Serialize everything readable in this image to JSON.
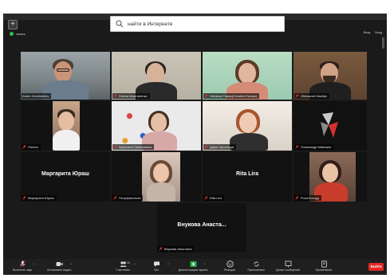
{
  "search": {
    "placeholder": "найти в Интернете"
  },
  "status": {
    "label": "запись"
  },
  "top_right": {
    "item1": "Вход",
    "item2": "Вход"
  },
  "participants": [
    {
      "id": "p1",
      "name": "Anton Ovchinnikov",
      "muted": false,
      "active": true
    },
    {
      "id": "p2",
      "name": "Олена Мартиненко",
      "muted": true
    },
    {
      "id": "p3",
      "name": "Наталка Тимко(Creative Europe)",
      "muted": true
    },
    {
      "id": "p4",
      "name": "Oleksandr Manilyk",
      "muted": true
    },
    {
      "id": "p5",
      "name": "Поліна",
      "muted": true
    },
    {
      "id": "p6",
      "name": "Христина Омельченко",
      "muted": true
    },
    {
      "id": "p7",
      "name": "Дарія Хроллида",
      "muted": true
    },
    {
      "id": "p8",
      "name": "Олександр Манішкін",
      "muted": true
    },
    {
      "id": "p9",
      "name": "Маргарита Юраш",
      "muted": true,
      "display_name": "Маргарита Юраш"
    },
    {
      "id": "p10",
      "name": "Потрерікальна",
      "muted": true
    },
    {
      "id": "p11",
      "name": "Rita Lira",
      "muted": true,
      "display_name": "Rita Lira"
    },
    {
      "id": "p12",
      "name": "Роса Богоуд",
      "muted": true
    },
    {
      "id": "p13",
      "name": "Внукова Анастасія",
      "muted": true,
      "display_name": "Внукова Анаста..."
    }
  ],
  "toolbar": {
    "mute": "Включить звук",
    "video": "Остановить видео",
    "participants": "Участники",
    "participants_count": "13",
    "chat": "Чат",
    "share": "Демонстрация экрана",
    "reactions": "Реакции",
    "apps": "Приложения",
    "whiteboard": "Доски сообщений",
    "notes": "Примечания",
    "leave": "Выйти"
  },
  "colors": {
    "active_outline": "#c8e05a",
    "leave": "#e02828",
    "share": "#23b04a",
    "muted": "#e03030"
  }
}
